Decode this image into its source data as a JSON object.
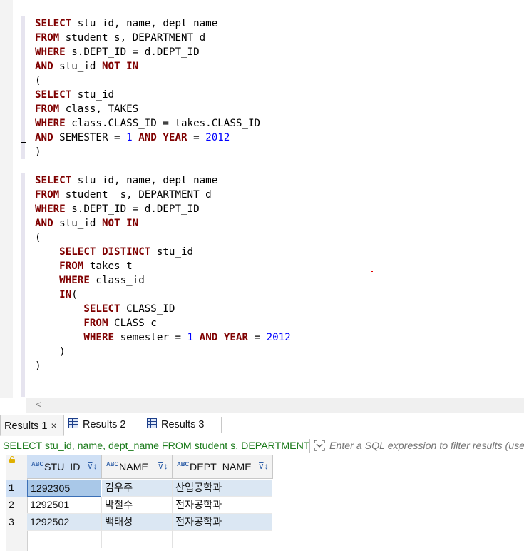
{
  "editor": {
    "query1": {
      "line1": [
        "SELECT",
        " stu_id, name, dept_name"
      ],
      "line2": [
        "FROM",
        " student s, DEPARTMENT d"
      ],
      "line3": [
        "WHERE",
        " s.DEPT_ID = d.DEPT_ID"
      ],
      "line4": [
        "AND",
        " stu_id ",
        "NOT",
        " ",
        "IN"
      ],
      "line5": "(",
      "line6": [
        "SELECT",
        " stu_id"
      ],
      "line7": [
        "FROM",
        " class, TAKES"
      ],
      "line8": [
        "WHERE",
        " class.CLASS_ID = takes.CLASS_ID"
      ],
      "line9": [
        "AND",
        " SEMESTER = ",
        "1",
        " ",
        "AND",
        " ",
        "YEAR",
        " = ",
        "2012"
      ],
      "line10": ")"
    },
    "query2": {
      "line1": [
        "SELECT",
        " stu_id, name, dept_name"
      ],
      "line2": [
        "FROM",
        " student  s, DEPARTMENT d"
      ],
      "line3": [
        "WHERE",
        " s.DEPT_ID = d.DEPT_ID"
      ],
      "line4": [
        "AND",
        " stu_id ",
        "NOT",
        " ",
        "IN"
      ],
      "line5": "(",
      "line6": [
        "    ",
        "SELECT",
        " ",
        "DISTINCT",
        " stu_id"
      ],
      "line7": [
        "    ",
        "FROM",
        " takes t"
      ],
      "line8": [
        "    ",
        "WHERE",
        " class_id"
      ],
      "line9": [
        "    ",
        "IN",
        "("
      ],
      "line10": [
        "        ",
        "SELECT",
        " CLASS_ID"
      ],
      "line11": [
        "        ",
        "FROM",
        " CLASS c"
      ],
      "line12": [
        "        ",
        "WHERE",
        " semester = ",
        "1",
        " ",
        "AND",
        " ",
        "YEAR",
        " = ",
        "2012"
      ],
      "line13": "    )",
      "line14": ")"
    }
  },
  "tabs": [
    {
      "label": "Results 1",
      "close": "×"
    },
    {
      "label": "Results 2"
    },
    {
      "label": "Results 3"
    }
  ],
  "filter": {
    "query_text": "SELECT stu_id, name, dept_name FROM student s, DEPARTMENT d",
    "placeholder": "Enter a SQL expression to filter results (use Ctrl+Space)"
  },
  "grid": {
    "abc_badge": "ABC",
    "columns": [
      "STU_ID",
      "NAME",
      "DEPT_NAME"
    ],
    "rows": [
      {
        "num": "1",
        "stu_id": "1292305",
        "name": "김우주",
        "dept_name": "산업공학과"
      },
      {
        "num": "2",
        "stu_id": "1292501",
        "name": "박철수",
        "dept_name": "전자공학과"
      },
      {
        "num": "3",
        "stu_id": "1292502",
        "name": "백태성",
        "dept_name": "전자공학과"
      }
    ]
  },
  "colors": {
    "keyword": "#7f0000",
    "number": "#0000ff",
    "filter_query": "#1a7a1a",
    "selection": "#cfe0f5"
  }
}
